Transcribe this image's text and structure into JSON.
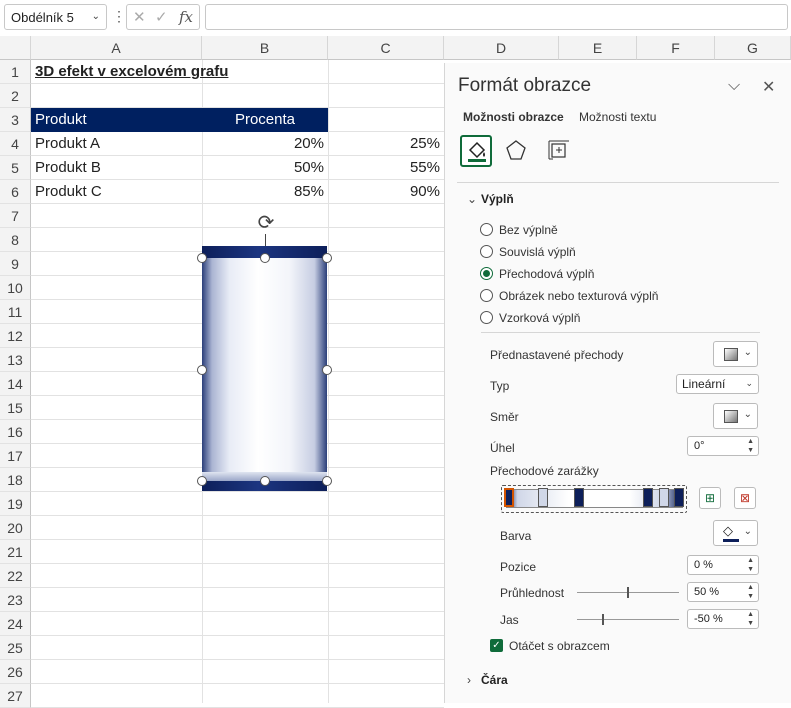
{
  "formula_bar": {
    "name_box": "Obdélník 5",
    "fx": "fx",
    "cancel": "✕",
    "enter": "✓",
    "dots": "⋮",
    "value": ""
  },
  "columns": [
    "A",
    "B",
    "C",
    "D",
    "E",
    "F",
    "G"
  ],
  "rows": [
    "1",
    "2",
    "3",
    "4",
    "5",
    "6",
    "7",
    "8",
    "9",
    "10",
    "11",
    "12",
    "13",
    "14",
    "15",
    "16",
    "17",
    "18",
    "19",
    "20",
    "21",
    "22",
    "23",
    "24",
    "25",
    "26",
    "27"
  ],
  "cells": {
    "A1": "3D efekt v excelovém grafu",
    "A3": "Produkt",
    "B3": "Procenta",
    "A4": "Produkt A",
    "B4": "20%",
    "C4": "25%",
    "A5": "Produkt B",
    "B5": "50%",
    "C5": "55%",
    "A6": "Produkt C",
    "B6": "85%",
    "C6": "90%"
  },
  "panel": {
    "title": "Formát obrazce",
    "tabs": [
      "Možnosti obrazce",
      "Možnosti textu"
    ],
    "active_tab": "Možnosti obrazce",
    "fill_section": "Výplň",
    "fill_options": [
      "Bez výplně",
      "Souvislá výplň",
      "Přechodová výplň",
      "Obrázek nebo texturová výplň",
      "Vzorková výplň"
    ],
    "selected_fill": "Přechodová výplň",
    "preset_gradients_label": "Přednastavené přechody",
    "type_label": "Typ",
    "type_value": "Lineární",
    "direction_label": "Směr",
    "angle_label": "Úhel",
    "angle_value": "0°",
    "gradient_stops_label": "Přechodové zarážky",
    "color_label": "Barva",
    "position_label": "Pozice",
    "position_value": "0 %",
    "transparency_label": "Průhlednost",
    "transparency_value": "50 %",
    "transparency_level": 0.5,
    "brightness_label": "Jas",
    "brightness_value": "-50 %",
    "brightness_level": 0.25,
    "rotate_label": "Otáčet s obrazcem",
    "rotate_checked": true,
    "line_section": "Čára"
  },
  "colors": {
    "header_fill": "#002060",
    "accent": "#0f6b3a",
    "stop_dark": "#0d1f5a"
  }
}
